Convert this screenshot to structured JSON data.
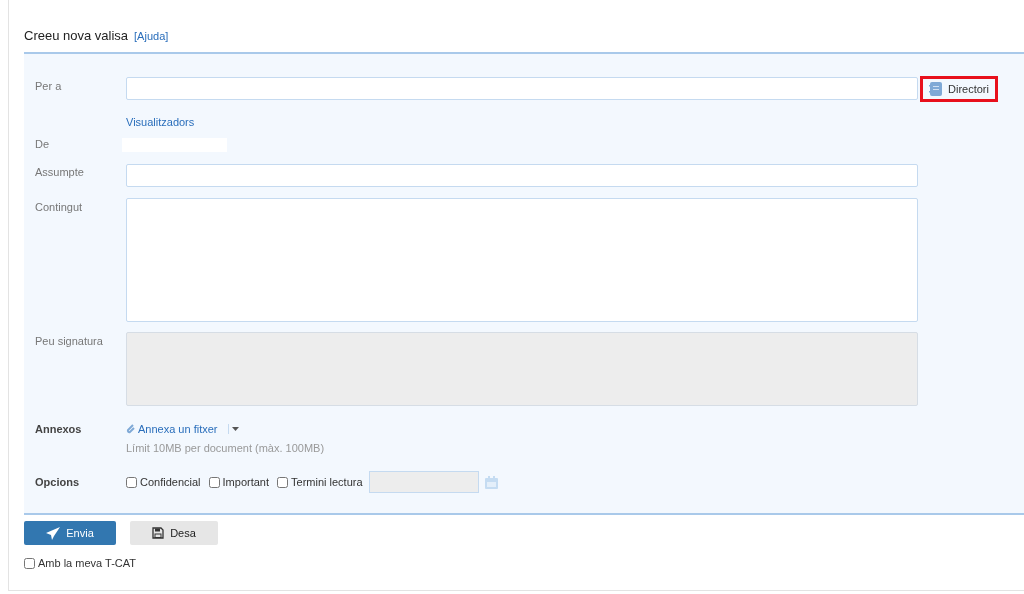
{
  "header": {
    "title": "Creeu nova valisa",
    "help_link": "[Ajuda]"
  },
  "form": {
    "recipient": {
      "label": "Per a",
      "directory_button": "Directori",
      "highlighted": true,
      "viewers_link": "Visualitzadors"
    },
    "sender": {
      "label": "De"
    },
    "subject": {
      "label": "Assumpte"
    },
    "content": {
      "label": "Contingut"
    },
    "signature": {
      "label": "Peu signatura",
      "disabled": true
    },
    "attachments": {
      "label": "Annexos",
      "attach_link": "Annexa un fitxer",
      "limit_note": "Límit 10MB per document (màx. 100MB)"
    },
    "options": {
      "label": "Opcions",
      "checkboxes": [
        {
          "label": "Confidencial",
          "checked": false
        },
        {
          "label": "Important",
          "checked": false
        },
        {
          "label": "Termini lectura",
          "checked": false
        }
      ],
      "deadline_disabled": true
    }
  },
  "actions": {
    "send": "Envia",
    "save": "Desa",
    "tcat": {
      "label": "Amb la meva T-CAT",
      "checked": false
    }
  }
}
